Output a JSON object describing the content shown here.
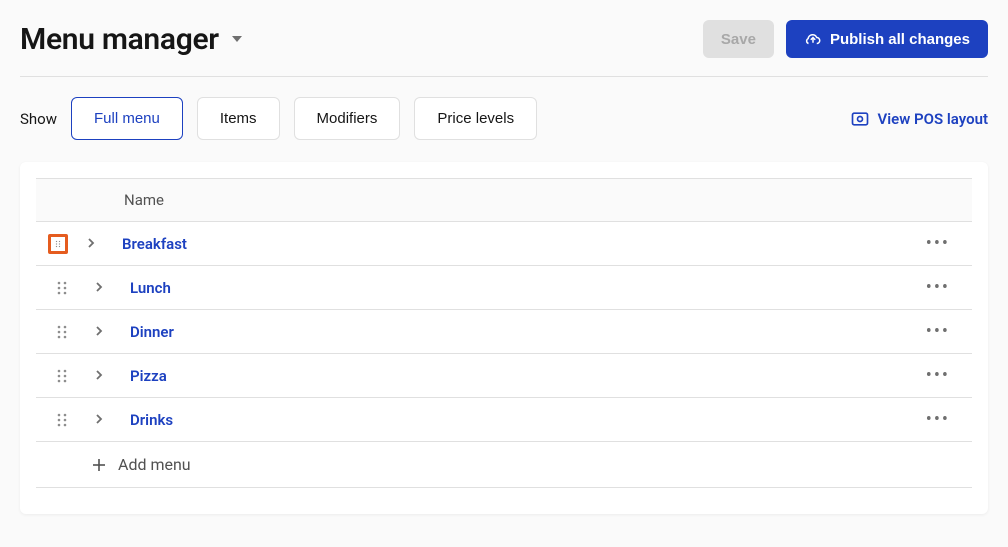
{
  "header": {
    "title": "Menu manager",
    "save_label": "Save",
    "publish_label": "Publish all changes"
  },
  "filters": {
    "show_label": "Show",
    "tabs": [
      {
        "label": "Full menu",
        "active": true
      },
      {
        "label": "Items",
        "active": false
      },
      {
        "label": "Modifiers",
        "active": false
      },
      {
        "label": "Price levels",
        "active": false
      }
    ],
    "view_pos_label": "View POS layout"
  },
  "table": {
    "column_header": "Name",
    "rows": [
      {
        "name": "Breakfast",
        "highlighted": true
      },
      {
        "name": "Lunch",
        "highlighted": false
      },
      {
        "name": "Dinner",
        "highlighted": false
      },
      {
        "name": "Pizza",
        "highlighted": false
      },
      {
        "name": "Drinks",
        "highlighted": false
      }
    ],
    "add_label": "Add menu"
  }
}
